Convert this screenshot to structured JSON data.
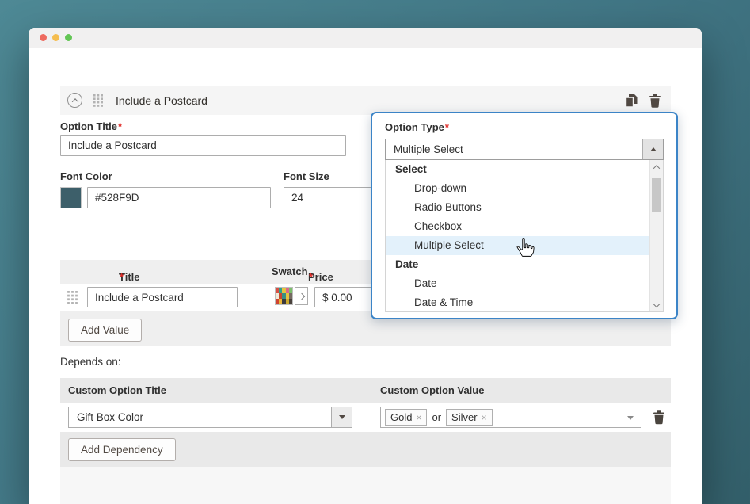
{
  "colors": {
    "accent_blue": "#3b84c7",
    "highlight_blue": "#e3f1fb",
    "font_color_swatch": "#3d5f6a",
    "traffic_lights": [
      "#ee6a5f",
      "#f5bd4f",
      "#62c554"
    ]
  },
  "option_card": {
    "title": "Include a Postcard",
    "option_title": {
      "label": "Option Title",
      "required_mark": "*",
      "value": "Include a Postcard"
    },
    "font_color": {
      "label": "Font Color",
      "value": "#528F9D"
    },
    "font_size": {
      "label": "Font Size",
      "value": "24"
    }
  },
  "option_type_panel": {
    "label": "Option Type",
    "required_mark": "*",
    "selected_value": "Multiple Select",
    "list": {
      "group1_label": "Select",
      "group1_options": [
        "Drop-down",
        "Radio Buttons",
        "Checkbox",
        "Multiple Select"
      ],
      "group2_label": "Date",
      "group2_options": [
        "Date",
        "Date & Time"
      ],
      "highlighted_option": "Multiple Select"
    }
  },
  "values_table": {
    "headers": {
      "title": "Title",
      "title_required": "*",
      "swatch": "Swatch",
      "price": "Price",
      "price_required": "*"
    },
    "row": {
      "title_value": "Include a Postcard",
      "price_value": "$ 0.00",
      "swatch_colors": [
        "#d94f43",
        "#2ea08e",
        "#e7c33f",
        "#d96a8a",
        "#7bbf6a",
        "#f0ead8",
        "#c8472f",
        "#3a8f84",
        "#e7c33f",
        "#756a62",
        "#cf4331",
        "#e8b73a",
        "#3c3a3d",
        "#caa92f",
        "#49413c"
      ]
    },
    "add_value_label": "Add Value"
  },
  "dependency_section": {
    "heading": "Depends on:",
    "headers": {
      "title": "Custom Option Title",
      "value": "Custom Option Value"
    },
    "row": {
      "title_value": "Gift Box Color",
      "value_tags": [
        "Gold",
        "Silver"
      ],
      "tag_joiner": "or",
      "tag_remove": "×"
    },
    "add_dependency_label": "Add Dependency"
  }
}
